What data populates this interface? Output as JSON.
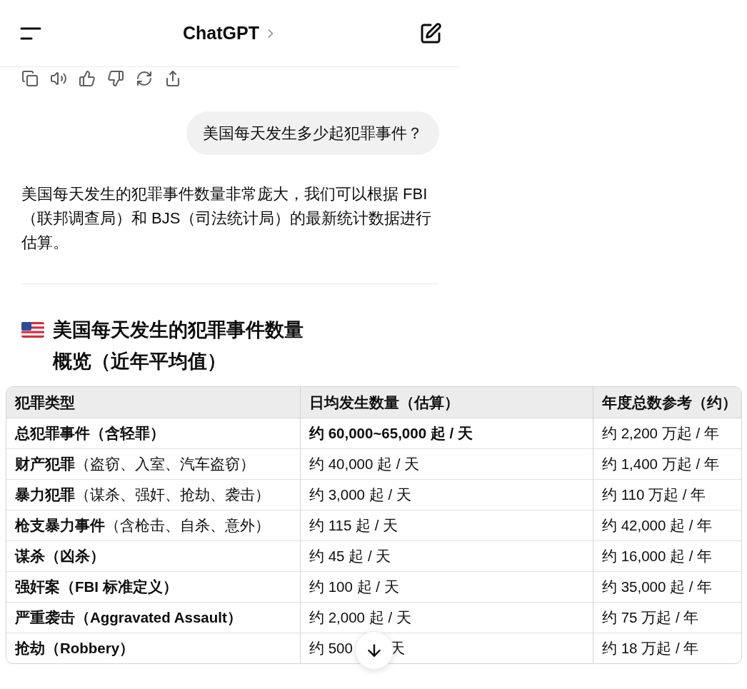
{
  "header": {
    "title": "ChatGPT"
  },
  "user_message": "美国每天发生多少起犯罪事件？",
  "answer": {
    "paragraph": "美国每天发生的犯罪事件数量非常庞大，我们可以根据 FBI（联邦调查局）和 BJS（司法统计局）的最新统计数据进行估算。",
    "heading": "美国每天发生的犯罪事件数量概览（近年平均值）"
  },
  "table": {
    "columns": [
      "犯罪类型",
      "日均发生数量（估算）",
      "年度总数参考（约）"
    ],
    "rows": [
      [
        {
          "text": "总犯罪事件（含轻罪）",
          "bold": true
        },
        {
          "text": "约 60,000~65,000 起 / 天",
          "bold": true
        },
        {
          "text": "约 2,200 万起 / 年",
          "bold": false
        }
      ],
      [
        {
          "text": "**财产犯罪**（盗窃、入室、汽车盗窃）",
          "bold": false
        },
        {
          "text": "约 40,000 起 / 天",
          "bold": false
        },
        {
          "text": "约 1,400 万起 / 年",
          "bold": false
        }
      ],
      [
        {
          "text": "**暴力犯罪**（谋杀、强奸、抢劫、袭击）",
          "bold": false
        },
        {
          "text": "约 3,000 起 / 天",
          "bold": false
        },
        {
          "text": "约 110 万起 / 年",
          "bold": false
        }
      ],
      [
        {
          "text": "**枪支暴力事件**（含枪击、自杀、意外）",
          "bold": false
        },
        {
          "text": "约 115 起 / 天",
          "bold": false
        },
        {
          "text": "约 42,000 起 / 年",
          "bold": false
        }
      ],
      [
        {
          "text": "谋杀（凶杀）",
          "bold": true
        },
        {
          "text": "约 45 起 / 天",
          "bold": false
        },
        {
          "text": "约 16,000 起 / 年",
          "bold": false
        }
      ],
      [
        {
          "text": "强奸案（FBI 标准定义）",
          "bold": true
        },
        {
          "text": "约 100 起 / 天",
          "bold": false
        },
        {
          "text": "约 35,000 起 / 年",
          "bold": false
        }
      ],
      [
        {
          "text": "严重袭击（Aggravated Assault）",
          "bold": true
        },
        {
          "text": "约 2,000 起 / 天",
          "bold": false
        },
        {
          "text": "约 75 万起 / 年",
          "bold": false
        }
      ],
      [
        {
          "text": "抢劫（Robbery）",
          "bold": true
        },
        {
          "text": "约 500",
          "tail": "天",
          "bold": false
        },
        {
          "text": "约 18 万起 / 年",
          "bold": false
        }
      ]
    ]
  }
}
